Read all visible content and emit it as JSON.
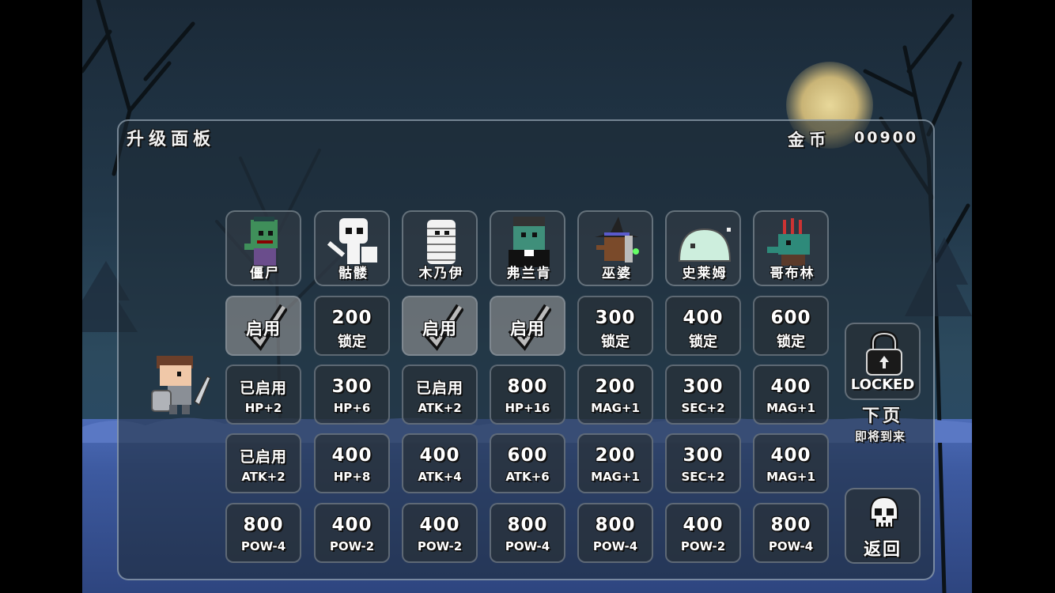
{
  "header": {
    "title": "升级面板",
    "coins_label": "金币",
    "coins_value": "00900"
  },
  "characters": [
    {
      "name": "僵尸",
      "icon": "zombie-icon",
      "action": {
        "type": "check",
        "label": "启用"
      }
    },
    {
      "name": "骷髅",
      "icon": "skeleton-icon",
      "action": {
        "type": "price",
        "top": "200",
        "bottom": "锁定"
      }
    },
    {
      "name": "木乃伊",
      "icon": "mummy-icon",
      "action": {
        "type": "check",
        "label": "启用"
      }
    },
    {
      "name": "弗兰肯",
      "icon": "frankenstein-icon",
      "action": {
        "type": "check",
        "label": "启用"
      }
    },
    {
      "name": "巫婆",
      "icon": "witch-icon",
      "action": {
        "type": "price",
        "top": "300",
        "bottom": "锁定"
      }
    },
    {
      "name": "史莱姆",
      "icon": "slime-icon",
      "action": {
        "type": "price",
        "top": "400",
        "bottom": "锁定"
      }
    },
    {
      "name": "哥布林",
      "icon": "goblin-icon",
      "action": {
        "type": "price",
        "top": "600",
        "bottom": "锁定"
      }
    }
  ],
  "upgrades": [
    [
      {
        "top": "已启用",
        "bottom": "HP+2"
      },
      {
        "top": "300",
        "bottom": "HP+6"
      },
      {
        "top": "已启用",
        "bottom": "ATK+2"
      },
      {
        "top": "800",
        "bottom": "HP+16"
      },
      {
        "top": "200",
        "bottom": "MAG+1"
      },
      {
        "top": "300",
        "bottom": "SEC+2"
      },
      {
        "top": "400",
        "bottom": "MAG+1"
      }
    ],
    [
      {
        "top": "已启用",
        "bottom": "ATK+2"
      },
      {
        "top": "400",
        "bottom": "HP+8"
      },
      {
        "top": "400",
        "bottom": "ATK+4"
      },
      {
        "top": "600",
        "bottom": "ATK+6"
      },
      {
        "top": "200",
        "bottom": "MAG+1"
      },
      {
        "top": "300",
        "bottom": "SEC+2"
      },
      {
        "top": "400",
        "bottom": "MAG+1"
      }
    ],
    [
      {
        "top": "800",
        "bottom": "POW-4"
      },
      {
        "top": "400",
        "bottom": "POW-2"
      },
      {
        "top": "400",
        "bottom": "POW-2"
      },
      {
        "top": "800",
        "bottom": "POW-4"
      },
      {
        "top": "800",
        "bottom": "POW-4"
      },
      {
        "top": "400",
        "bottom": "POW-2"
      },
      {
        "top": "800",
        "bottom": "POW-4"
      }
    ]
  ],
  "side": {
    "locked_label": "LOCKED",
    "next_label": "下页",
    "coming_soon": "即将到来",
    "back_label": "返回",
    "lock_icon": "padlock-icon",
    "skull_icon": "skull-icon"
  },
  "colors": {
    "ground": "#3d5aa0",
    "sky": "#22384a",
    "moon": "#e8d89a"
  }
}
